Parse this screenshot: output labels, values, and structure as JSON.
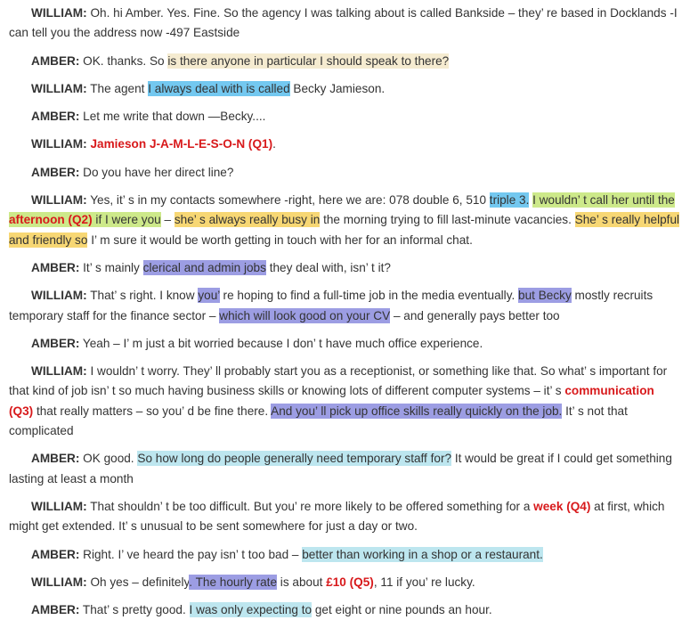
{
  "transcript": [
    {
      "speaker": "WILLIAM:",
      "segs": [
        {
          "t": " Oh. hi Amber. Yes. Fine. So the agency I was talking about is called Bankside – they’ re based in Docklands -I can tell you the address now -497 Eastside"
        }
      ]
    },
    {
      "speaker": "AMBER:",
      "segs": [
        {
          "t": " OK. thanks. So "
        },
        {
          "t": "is there anyone in particular I should speak to there?",
          "hl": "cream"
        }
      ]
    },
    {
      "speaker": "WILLIAM:",
      "segs": [
        {
          "t": " The agent "
        },
        {
          "t": "I always deal with is called",
          "hl": "blue"
        },
        {
          "t": " Becky Jamieson."
        }
      ]
    },
    {
      "speaker": "AMBER:",
      "segs": [
        {
          "t": " Let me write that down —Becky...."
        }
      ]
    },
    {
      "speaker": "WILLIAM:",
      "segs": [
        {
          "t": " "
        },
        {
          "t": "Jamieson J-A-M-L-E-S-O-N (Q1)",
          "ans": true
        },
        {
          "t": "."
        }
      ]
    },
    {
      "speaker": "AMBER:",
      "segs": [
        {
          "t": " Do you have her direct line?"
        }
      ]
    },
    {
      "speaker": "WILLIAM:",
      "segs": [
        {
          "t": " Yes, it’ s in my contacts somewhere -right, here we are: 078 double 6, 510 "
        },
        {
          "t": "triple 3.",
          "hl": "blue"
        },
        {
          "t": " "
        },
        {
          "t": "I wouldn’ t call her until the ",
          "hl": "green"
        },
        {
          "t": "afternoon (Q2)",
          "hl": "green",
          "ans": true
        },
        {
          "t": " if I were you",
          "hl": "green"
        },
        {
          "t": " – "
        },
        {
          "t": "she’ s always really busy in",
          "hl": "yellow"
        },
        {
          "t": " the morning trying to fill last-minute vacancies. "
        },
        {
          "t": "She’ s really helpful and friendly so",
          "hl": "yellow"
        },
        {
          "t": " I’ m sure it would be worth getting in touch with her for an informal chat."
        }
      ]
    },
    {
      "speaker": "AMBER:",
      "segs": [
        {
          "t": " It’ s mainly "
        },
        {
          "t": "clerical and admin jobs",
          "hl": "purple"
        },
        {
          "t": " they deal with, isn’ t it?"
        }
      ]
    },
    {
      "speaker": "WILLIAM:",
      "segs": [
        {
          "t": " That’ s right. I know "
        },
        {
          "t": "you’",
          "hl": "purple"
        },
        {
          "t": " re hoping to find a full-time job in the media eventually. "
        },
        {
          "t": "but Becky",
          "hl": "purple"
        },
        {
          "t": " mostly recruits temporary staff for the finance sector – "
        },
        {
          "t": "which will look good on your CV",
          "hl": "purple"
        },
        {
          "t": " – and generally pays better too"
        }
      ]
    },
    {
      "speaker": "AMBER:",
      "segs": [
        {
          "t": " Yeah – I’ m just a bit worried because I don’ t have much office experience."
        }
      ]
    },
    {
      "speaker": "WILLIAM:",
      "segs": [
        {
          "t": " I wouldn’ t worry. They’ ll probably start you as a receptionist, or something like that. So what’ s important for that kind of job isn’ t so much having business skills or knowing lots of different computer systems – it’ s "
        },
        {
          "t": "communication (Q3)",
          "ans": true
        },
        {
          "t": " that really matters – so you’ d be fine there. "
        },
        {
          "t": "And you’ ll pick up office skills really quickly on the job.",
          "hl": "purple"
        },
        {
          "t": " It’ s not that complicated"
        }
      ]
    },
    {
      "speaker": "AMBER:",
      "segs": [
        {
          "t": " OK good. "
        },
        {
          "t": "So how long do people generally need temporary staff for?",
          "hl": "cyan"
        },
        {
          "t": " It would be great if I could get something lasting at least a month"
        }
      ]
    },
    {
      "speaker": "WILLIAM:",
      "segs": [
        {
          "t": " That shouldn’ t be too difficult. But you’ re more likely to be offered something for a "
        },
        {
          "t": "week (Q4)",
          "ans": true
        },
        {
          "t": " at first, which might get extended. It’ s unusual to be sent somewhere for just a day or two."
        }
      ]
    },
    {
      "speaker": "AMBER:",
      "segs": [
        {
          "t": " Right. I’ ve heard the pay isn’ t too bad – "
        },
        {
          "t": "better than working in a shop or a restaurant.",
          "hl": "cyan"
        }
      ]
    },
    {
      "speaker": "WILLIAM:",
      "segs": [
        {
          "t": " Oh yes – definitely"
        },
        {
          "t": ". The hourly rate",
          "hl": "purple"
        },
        {
          "t": " is about "
        },
        {
          "t": "£10 (Q5)",
          "ans": true
        },
        {
          "t": ", 11 if you’ re lucky."
        }
      ]
    },
    {
      "speaker": "AMBER:",
      "segs": [
        {
          "t": " That’ s pretty good. "
        },
        {
          "t": "I was only expecting to",
          "hl": "cyan"
        },
        {
          "t": " get eight or nine pounds an hour."
        }
      ]
    }
  ]
}
